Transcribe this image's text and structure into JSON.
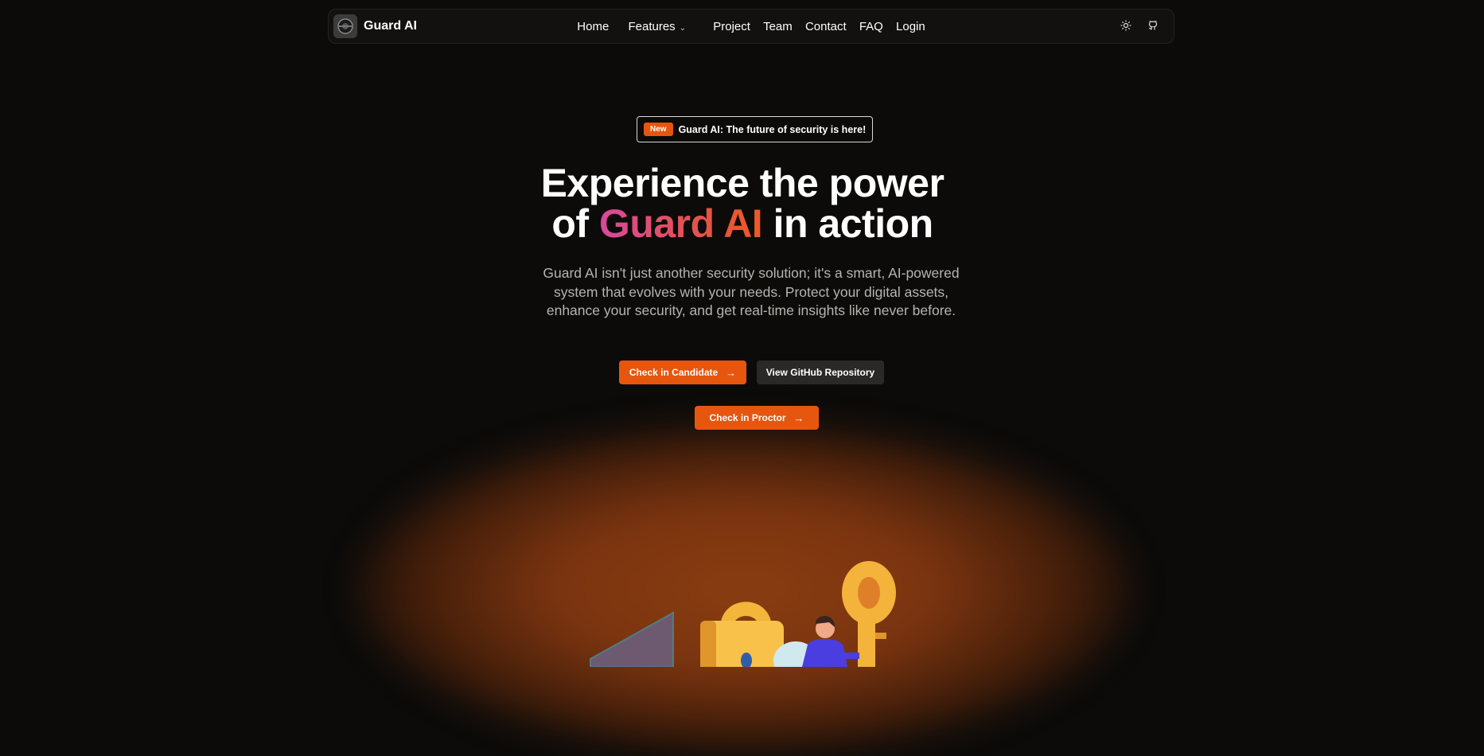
{
  "nav": {
    "brand": "Guard AI",
    "links": {
      "home": "Home",
      "features": "Features",
      "project": "Project",
      "team": "Team",
      "contact": "Contact",
      "faq": "FAQ",
      "login": "Login"
    },
    "icons": [
      "sun-icon",
      "github-icon"
    ]
  },
  "hero": {
    "badge_tag": "New",
    "badge_text": "Guard AI: The future of security is here!",
    "headline_line1": "Experience the power",
    "headline_of": "of",
    "headline_highlight": "Guard AI",
    "headline_end": "in action",
    "description": "Guard AI isn't just another security solution; it's a smart, AI-powered system that evolves with your needs. Protect your digital assets, enhance your security, and get real-time insights like never before.",
    "buttons": {
      "candidate": "Check in Candidate",
      "github": "View GitHub Repository",
      "proctor": "Check in Proctor"
    }
  },
  "colors": {
    "accent": "#e6560f",
    "background": "#0c0b0a",
    "gradient_start": "#d9489c",
    "gradient_end": "#ee5a24"
  }
}
